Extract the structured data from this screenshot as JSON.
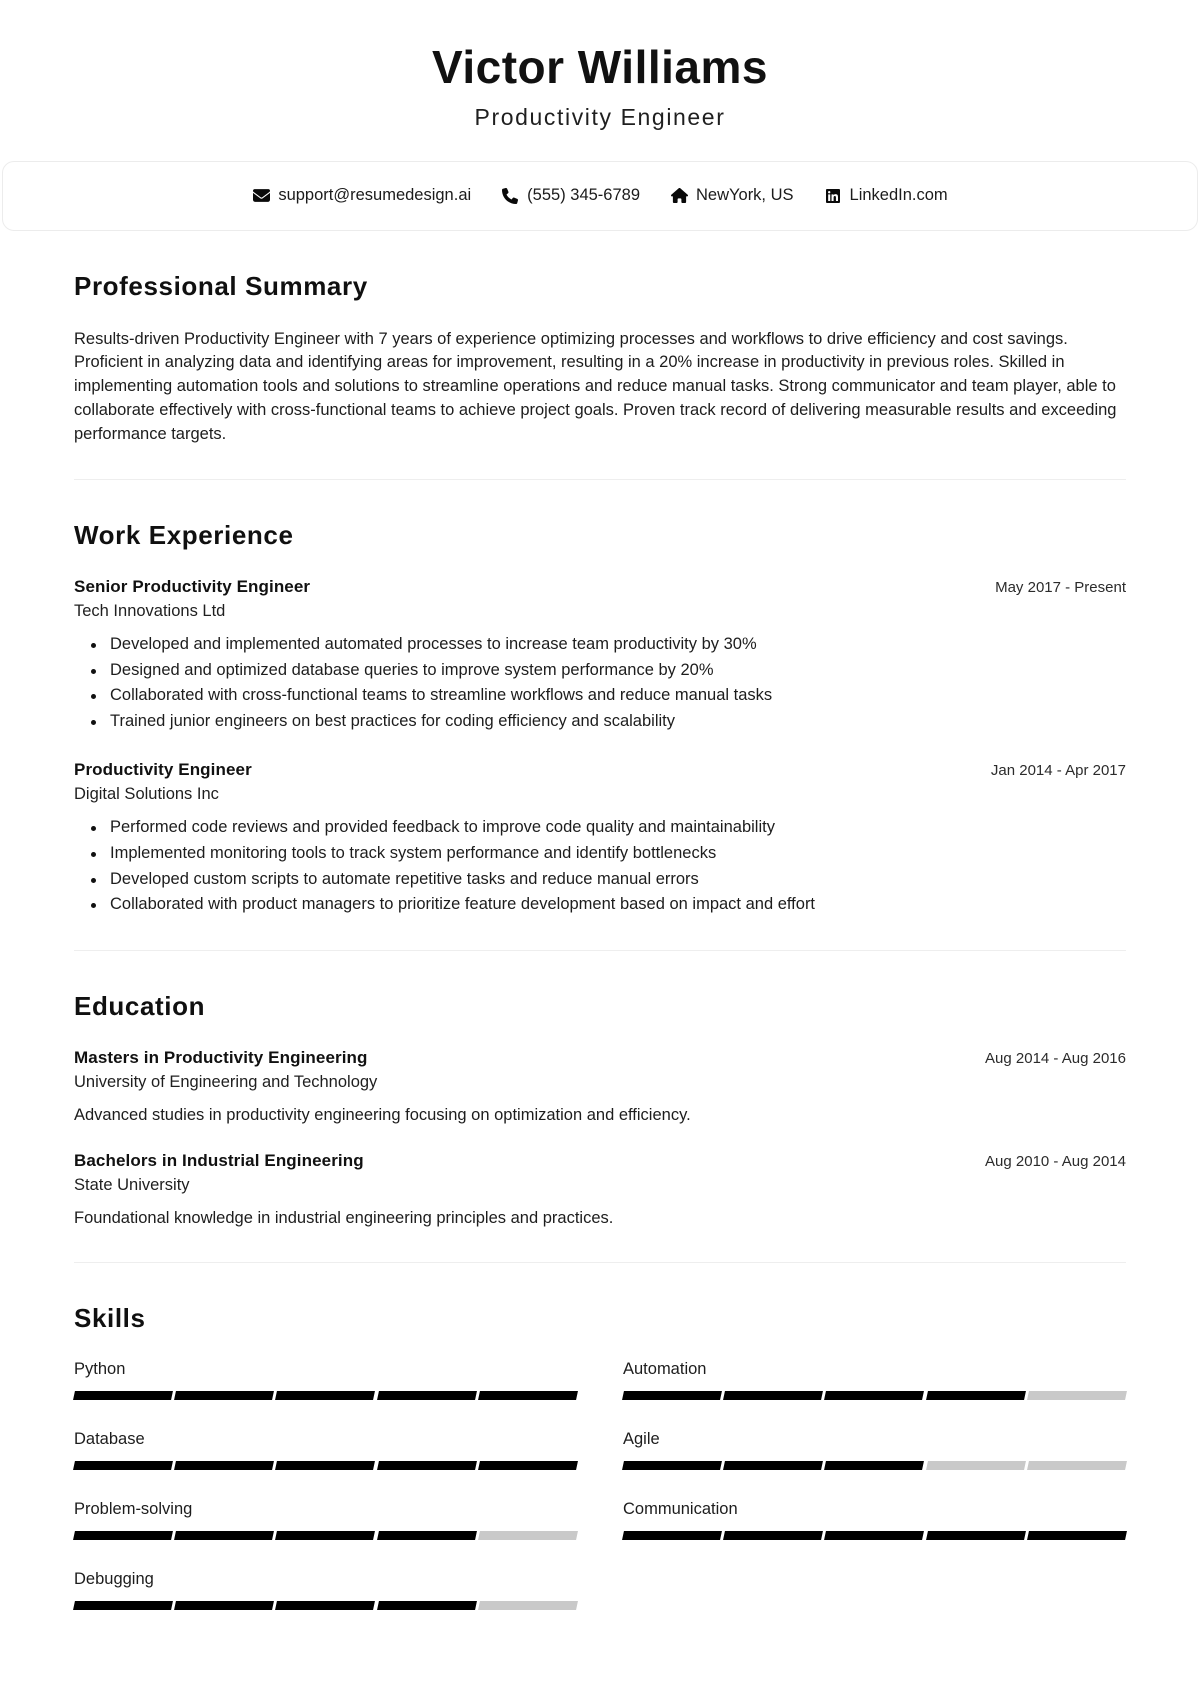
{
  "header": {
    "name": "Victor Williams",
    "role": "Productivity Engineer"
  },
  "contact": {
    "items": [
      {
        "icon": "envelope-icon",
        "label": "support@resumedesign.ai"
      },
      {
        "icon": "phone-icon",
        "label": "(555) 345-6789"
      },
      {
        "icon": "home-icon",
        "label": "NewYork, US"
      },
      {
        "icon": "linkedin-icon",
        "label": "LinkedIn.com"
      }
    ]
  },
  "summary": {
    "title": "Professional Summary",
    "text": "Results-driven Productivity Engineer with 7 years of experience optimizing processes and workflows to drive efficiency and cost savings. Proficient in analyzing data and identifying areas for improvement, resulting in a 20% increase in productivity in previous roles. Skilled in implementing automation tools and solutions to streamline operations and reduce manual tasks. Strong communicator and team player, able to collaborate effectively with cross-functional teams to achieve project goals. Proven track record of delivering measurable results and exceeding performance targets."
  },
  "experience": {
    "title": "Work Experience",
    "entries": [
      {
        "title": "Senior Productivity Engineer",
        "company": "Tech Innovations Ltd",
        "date": "May 2017 - Present",
        "bullets": [
          "Developed and implemented automated processes to increase team productivity by 30%",
          "Designed and optimized database queries to improve system performance by 20%",
          "Collaborated with cross-functional teams to streamline workflows and reduce manual tasks",
          "Trained junior engineers on best practices for coding efficiency and scalability"
        ]
      },
      {
        "title": "Productivity Engineer",
        "company": "Digital Solutions Inc",
        "date": "Jan 2014 - Apr 2017",
        "bullets": [
          "Performed code reviews and provided feedback to improve code quality and maintainability",
          "Implemented monitoring tools to track system performance and identify bottlenecks",
          "Developed custom scripts to automate repetitive tasks and reduce manual errors",
          "Collaborated with product managers to prioritize feature development based on impact and effort"
        ]
      }
    ]
  },
  "education": {
    "title": "Education",
    "entries": [
      {
        "title": "Masters in Productivity Engineering",
        "school": "University of Engineering and Technology",
        "date": "Aug 2014 - Aug 2016",
        "description": "Advanced studies in productivity engineering focusing on optimization and efficiency."
      },
      {
        "title": "Bachelors in Industrial Engineering",
        "school": "State University",
        "date": "Aug 2010 - Aug 2014",
        "description": "Foundational knowledge in industrial engineering principles and practices."
      }
    ]
  },
  "skills": {
    "title": "Skills",
    "max_level": 5,
    "items": [
      {
        "name": "Python",
        "level": 5
      },
      {
        "name": "Automation",
        "level": 4
      },
      {
        "name": "Database",
        "level": 5
      },
      {
        "name": "Agile",
        "level": 3
      },
      {
        "name": "Problem-solving",
        "level": 4
      },
      {
        "name": "Communication",
        "level": 5
      },
      {
        "name": "Debugging",
        "level": 4
      }
    ]
  },
  "colors": {
    "filled": "#000000",
    "empty": "#c9c9c9",
    "text": "#1d1d1d",
    "divider": "#eeeeee"
  }
}
